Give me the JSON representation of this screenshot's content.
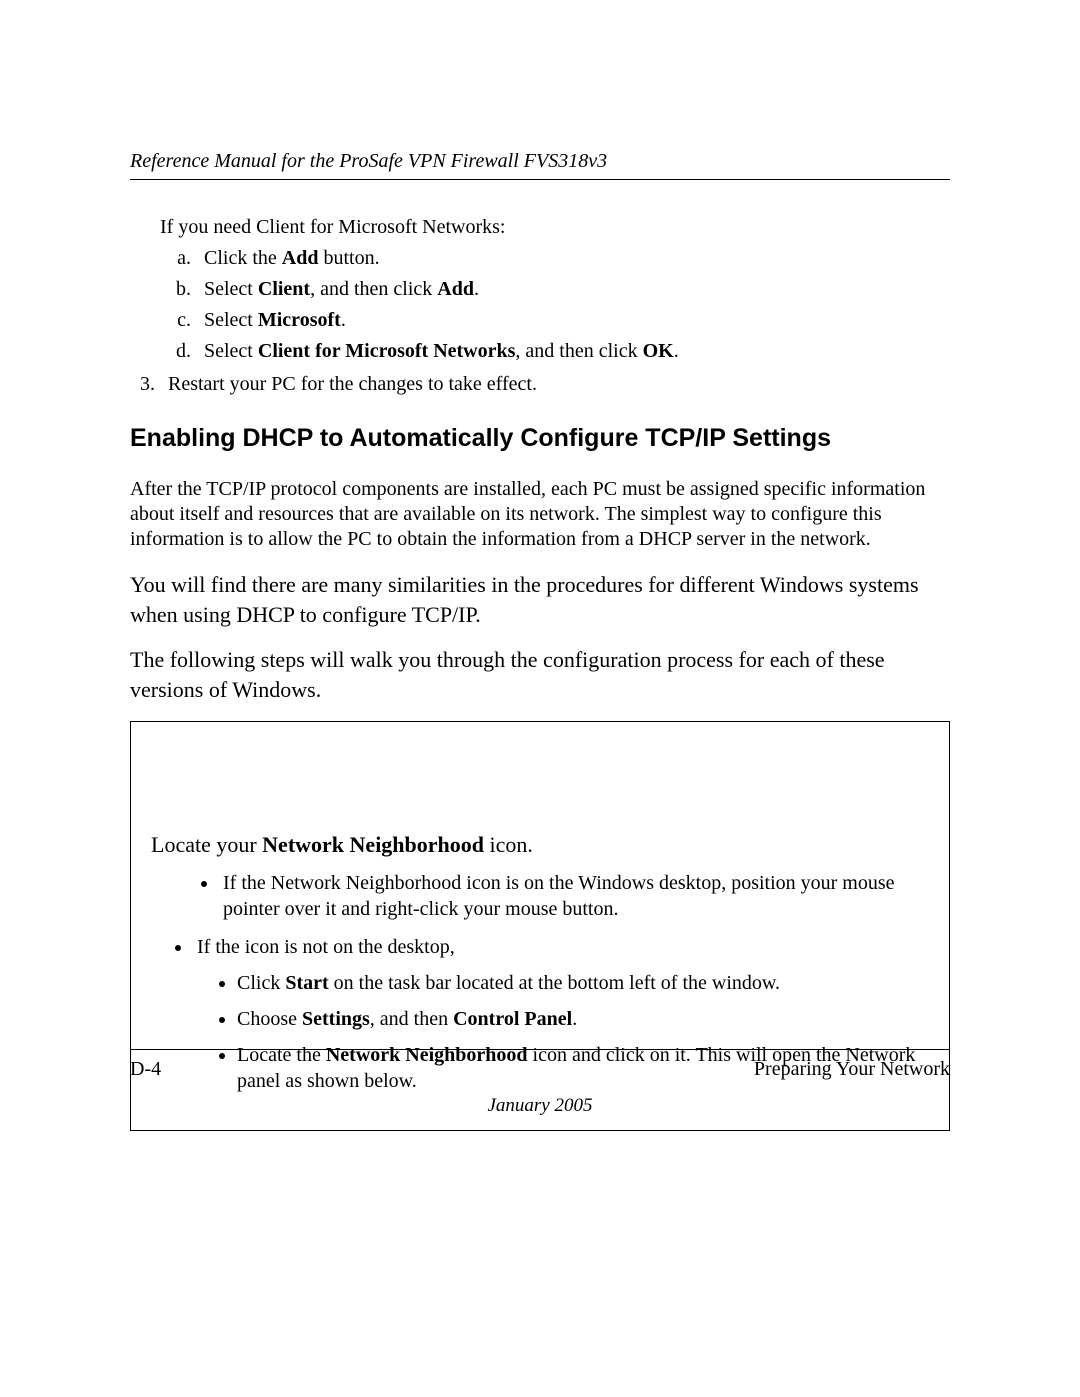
{
  "header": "Reference Manual for the ProSafe VPN Firewall FVS318v3",
  "intro": "If you need Client for Microsoft Networks:",
  "letters": {
    "a_pre": "Click the ",
    "a_b": "Add",
    "a_post": " button.",
    "b_pre": "Select ",
    "b_b1": "Client",
    "b_mid": ", and then click ",
    "b_b2": "Add",
    "b_post": ".",
    "c_pre": "Select ",
    "c_b": "Microsoft",
    "c_post": ".",
    "d_pre": "Select ",
    "d_b": "Client for Microsoft Networks",
    "d_mid": ", and then click ",
    "d_b2": "OK",
    "d_post": "."
  },
  "step3": "Restart your PC for the changes to take effect.",
  "section_heading": "Enabling DHCP to Automatically Configure TCP/IP Settings",
  "para1": "After the TCP/IP protocol components are installed, each PC must be assigned specific information about itself and resources that are available on its network. The simplest way to configure this information is to allow the PC to obtain the information from a DHCP server in the network.",
  "para2": "You will find there are many similarities in the procedures for different Windows systems when using DHCP to configure TCP/IP.",
  "para3": "The following steps will walk you through the configuration process for each of these versions of Windows.",
  "box": {
    "locate_pre": "Locate your ",
    "locate_b": "Network Neighborhood",
    "locate_post": " icon.",
    "b1": "If the Network Neighborhood icon is on the Windows desktop, position your mouse pointer over it and right-click your mouse button.",
    "b2": "If the icon is not on the desktop,",
    "s1_pre": "Click ",
    "s1_b": "Start",
    "s1_post": " on the task bar located at the bottom left of the window.",
    "s2_pre": "Choose ",
    "s2_b1": "Settings",
    "s2_mid": ", and then ",
    "s2_b2": "Control Panel",
    "s2_post": ".",
    "s3_pre": "Locate the ",
    "s3_b": "Network Neighborhood",
    "s3_post": " icon and click on it. This will open the Network panel as shown below."
  },
  "footer": {
    "left": "D-4",
    "right": "Preparing Your Network",
    "date": "January 2005"
  }
}
